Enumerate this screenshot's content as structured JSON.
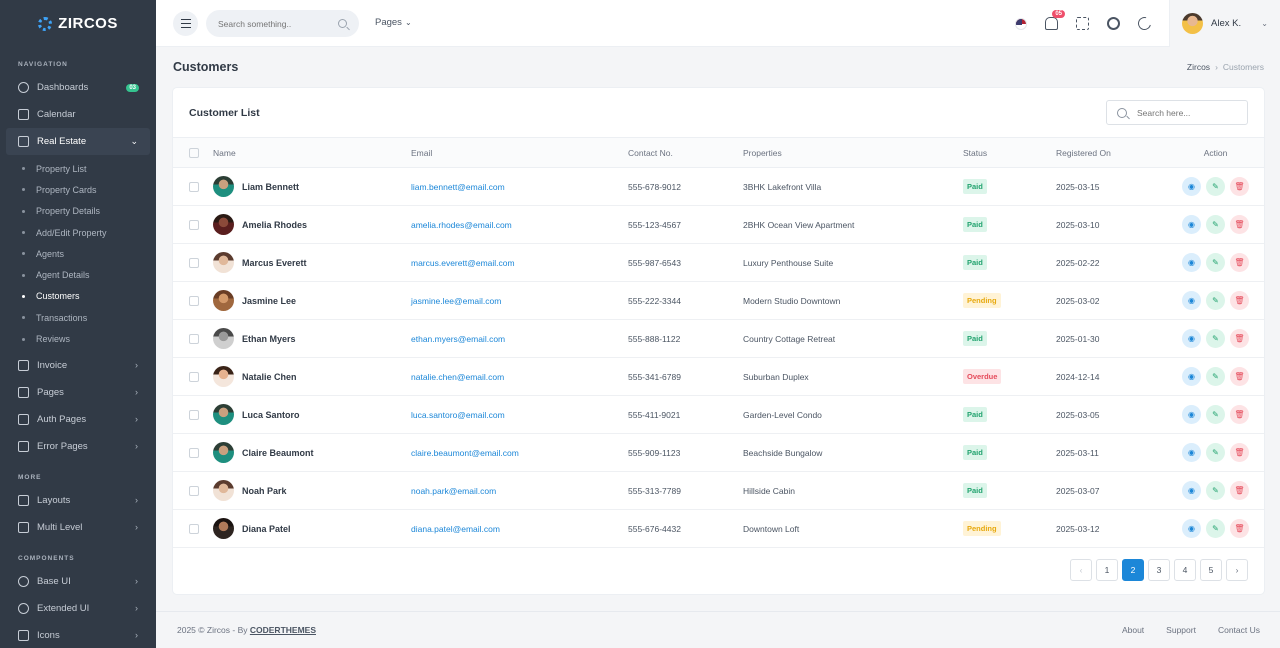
{
  "brand": {
    "name": "ZIRCOS"
  },
  "sidebar": {
    "sections": {
      "navigation": "NAVIGATION",
      "more": "MORE",
      "components": "COMPONENTS"
    },
    "dashboards": {
      "label": "Dashboards",
      "badge": "03"
    },
    "calendar": {
      "label": "Calendar"
    },
    "real_estate": {
      "label": "Real Estate"
    },
    "sub_items": [
      "Property List",
      "Property Cards",
      "Property Details",
      "Add/Edit Property",
      "Agents",
      "Agent Details",
      "Customers",
      "Transactions",
      "Reviews"
    ],
    "invoice": {
      "label": "Invoice"
    },
    "pages": {
      "label": "Pages"
    },
    "auth_pages": {
      "label": "Auth Pages"
    },
    "error_pages": {
      "label": "Error Pages"
    },
    "layouts": {
      "label": "Layouts"
    },
    "multi_level": {
      "label": "Multi Level"
    },
    "base_ui": {
      "label": "Base UI"
    },
    "extended_ui": {
      "label": "Extended UI"
    },
    "icons": {
      "label": "Icons"
    }
  },
  "topbar": {
    "search_placeholder": "Search something..",
    "pages_label": "Pages",
    "notification_count": "05",
    "user_name": "Alex K."
  },
  "page": {
    "title": "Customers",
    "breadcrumb_root": "Zircos",
    "breadcrumb_current": "Customers"
  },
  "card": {
    "title": "Customer List",
    "search_placeholder": "Search here..."
  },
  "table": {
    "headers": {
      "name": "Name",
      "email": "Email",
      "contact": "Contact No.",
      "properties": "Properties",
      "status": "Status",
      "registered": "Registered On",
      "action": "Action"
    },
    "rows": [
      {
        "name": "Liam Bennett",
        "email": "liam.bennett@email.com",
        "contact": "555-678-9012",
        "property": "3BHK Lakefront Villa",
        "status": "Paid",
        "date": "2025-03-15"
      },
      {
        "name": "Amelia Rhodes",
        "email": "amelia.rhodes@email.com",
        "contact": "555-123-4567",
        "property": "2BHK Ocean View Apartment",
        "status": "Paid",
        "date": "2025-03-10"
      },
      {
        "name": "Marcus Everett",
        "email": "marcus.everett@email.com",
        "contact": "555-987-6543",
        "property": "Luxury Penthouse Suite",
        "status": "Paid",
        "date": "2025-02-22"
      },
      {
        "name": "Jasmine Lee",
        "email": "jasmine.lee@email.com",
        "contact": "555-222-3344",
        "property": "Modern Studio Downtown",
        "status": "Pending",
        "date": "2025-03-02"
      },
      {
        "name": "Ethan Myers",
        "email": "ethan.myers@email.com",
        "contact": "555-888-1122",
        "property": "Country Cottage Retreat",
        "status": "Paid",
        "date": "2025-01-30"
      },
      {
        "name": "Natalie Chen",
        "email": "natalie.chen@email.com",
        "contact": "555-341-6789",
        "property": "Suburban Duplex",
        "status": "Overdue",
        "date": "2024-12-14"
      },
      {
        "name": "Luca Santoro",
        "email": "luca.santoro@email.com",
        "contact": "555-411-9021",
        "property": "Garden-Level Condo",
        "status": "Paid",
        "date": "2025-03-05"
      },
      {
        "name": "Claire Beaumont",
        "email": "claire.beaumont@email.com",
        "contact": "555-909-1123",
        "property": "Beachside Bungalow",
        "status": "Paid",
        "date": "2025-03-11"
      },
      {
        "name": "Noah Park",
        "email": "noah.park@email.com",
        "contact": "555-313-7789",
        "property": "Hillside Cabin",
        "status": "Paid",
        "date": "2025-03-07"
      },
      {
        "name": "Diana Patel",
        "email": "diana.patel@email.com",
        "contact": "555-676-4432",
        "property": "Downtown Loft",
        "status": "Pending",
        "date": "2025-03-12"
      }
    ]
  },
  "pagination": {
    "pages": [
      "1",
      "2",
      "3",
      "4",
      "5"
    ],
    "current": "2",
    "prev": "‹",
    "next": "›"
  },
  "footer": {
    "copyright": "2025 © Zircos - By ",
    "author": "CODERTHEMES",
    "links": [
      "About",
      "Support",
      "Contact Us"
    ]
  },
  "colors": {
    "sidebar_bg": "#313a46",
    "accent": "#1c87d8",
    "paid": "#22a36f",
    "pending": "#e7a90f",
    "overdue": "#e54b5b"
  }
}
